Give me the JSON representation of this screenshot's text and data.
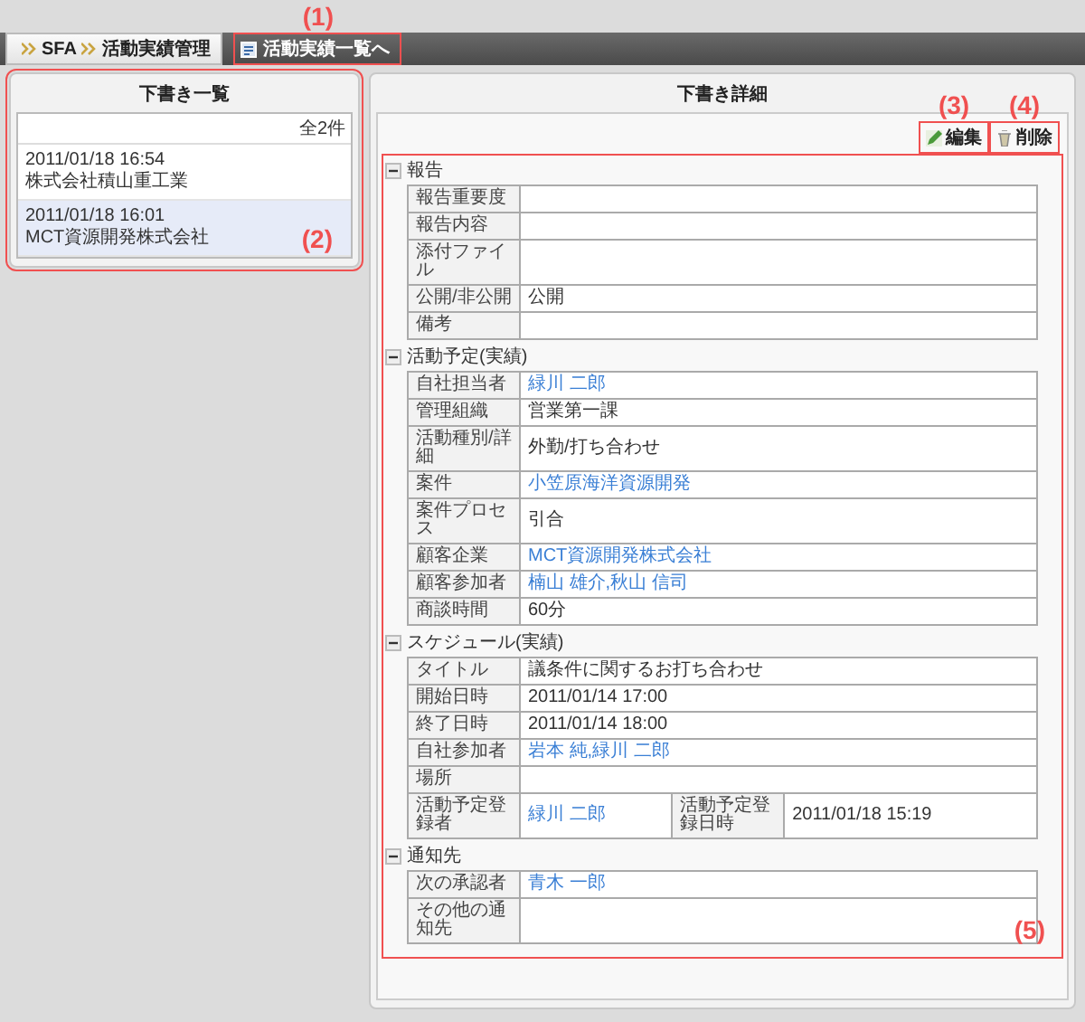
{
  "breadcrumb": [
    {
      "label": "SFA"
    },
    {
      "label": "活動実績管理"
    }
  ],
  "back_button": {
    "label": "活動実績一覧へ",
    "callout": "(1)"
  },
  "draft_list": {
    "title": "下書き一覧",
    "count": "全2件",
    "callout": "(2)",
    "items": [
      {
        "date": "2011/01/18 16:54",
        "company": "株式会社積山重工業",
        "selected": false
      },
      {
        "date": "2011/01/18 16:01",
        "company": "MCT資源開発株式会社",
        "selected": true
      }
    ]
  },
  "detail": {
    "title": "下書き詳細",
    "callout": "(5)",
    "buttons": [
      {
        "label": "編集",
        "kind": "edit",
        "callout": "(3)"
      },
      {
        "label": "削除",
        "kind": "delete",
        "callout": "(4)"
      }
    ],
    "sections": [
      {
        "title": "報告",
        "expanded": true,
        "rows": [
          {
            "cells": [
              {
                "kind": "label",
                "text": "報告重要度"
              },
              {
                "kind": "empty"
              }
            ]
          },
          {
            "cells": [
              {
                "kind": "label",
                "text": "報告内容"
              },
              {
                "kind": "empty"
              }
            ]
          },
          {
            "cells": [
              {
                "kind": "label",
                "text": "添付ファイル"
              },
              {
                "kind": "empty"
              }
            ]
          },
          {
            "cells": [
              {
                "kind": "label",
                "text": "公開/非公開"
              },
              {
                "kind": "text",
                "text": "公開"
              }
            ]
          },
          {
            "cells": [
              {
                "kind": "label",
                "text": "備考"
              },
              {
                "kind": "empty"
              }
            ]
          }
        ]
      },
      {
        "title": "活動予定(実績)",
        "expanded": true,
        "rows": [
          {
            "cells": [
              {
                "kind": "label",
                "text": "自社担当者"
              },
              {
                "kind": "link",
                "text": "緑川 二郎"
              }
            ]
          },
          {
            "cells": [
              {
                "kind": "label",
                "text": "管理組織"
              },
              {
                "kind": "text",
                "text": "営業第一課"
              }
            ]
          },
          {
            "cells": [
              {
                "kind": "label",
                "text": "活動種別/詳細"
              },
              {
                "kind": "text",
                "text": "外勤/打ち合わせ"
              }
            ]
          },
          {
            "cells": [
              {
                "kind": "label",
                "text": "案件"
              },
              {
                "kind": "link",
                "text": "小笠原海洋資源開発"
              }
            ]
          },
          {
            "cells": [
              {
                "kind": "label",
                "text": "案件プロセス"
              },
              {
                "kind": "text",
                "text": "引合"
              }
            ]
          },
          {
            "cells": [
              {
                "kind": "label",
                "text": "顧客企業"
              },
              {
                "kind": "link",
                "text": "MCT資源開発株式会社"
              }
            ]
          },
          {
            "cells": [
              {
                "kind": "label",
                "text": "顧客参加者"
              },
              {
                "kind": "link",
                "text": "楠山 雄介,秋山 信司"
              }
            ]
          },
          {
            "cells": [
              {
                "kind": "label",
                "text": "商談時間"
              },
              {
                "kind": "text",
                "text": "60分"
              }
            ]
          }
        ]
      },
      {
        "title": "スケジュール(実績)",
        "expanded": true,
        "rows": [
          {
            "cells": [
              {
                "kind": "label",
                "text": "タイトル"
              },
              {
                "kind": "text",
                "text": "議条件に関するお打ち合わせ",
                "colspan": 3
              }
            ]
          },
          {
            "cells": [
              {
                "kind": "label",
                "text": "開始日時"
              },
              {
                "kind": "text",
                "text": "2011/01/14 17:00",
                "colspan": 3
              }
            ]
          },
          {
            "cells": [
              {
                "kind": "label",
                "text": "終了日時"
              },
              {
                "kind": "text",
                "text": "2011/01/14 18:00",
                "colspan": 3
              }
            ]
          },
          {
            "cells": [
              {
                "kind": "label",
                "text": "自社参加者"
              },
              {
                "kind": "link",
                "text": "岩本 純,緑川 二郎",
                "colspan": 3
              }
            ]
          },
          {
            "cells": [
              {
                "kind": "label",
                "text": "場所"
              },
              {
                "kind": "empty",
                "colspan": 3
              }
            ]
          },
          {
            "cells": [
              {
                "kind": "label",
                "text": "活動予定登録者"
              },
              {
                "kind": "link",
                "text": "緑川 二郎"
              },
              {
                "kind": "label",
                "text": "活動予定登録日時"
              },
              {
                "kind": "text",
                "text": "2011/01/18 15:19"
              }
            ]
          }
        ]
      },
      {
        "title": "通知先",
        "expanded": true,
        "rows": [
          {
            "cells": [
              {
                "kind": "label",
                "text": "次の承認者"
              },
              {
                "kind": "link",
                "text": "青木 一郎"
              }
            ]
          },
          {
            "cells": [
              {
                "kind": "label",
                "text": "その他の通知先"
              },
              {
                "kind": "empty"
              }
            ]
          }
        ]
      }
    ]
  }
}
